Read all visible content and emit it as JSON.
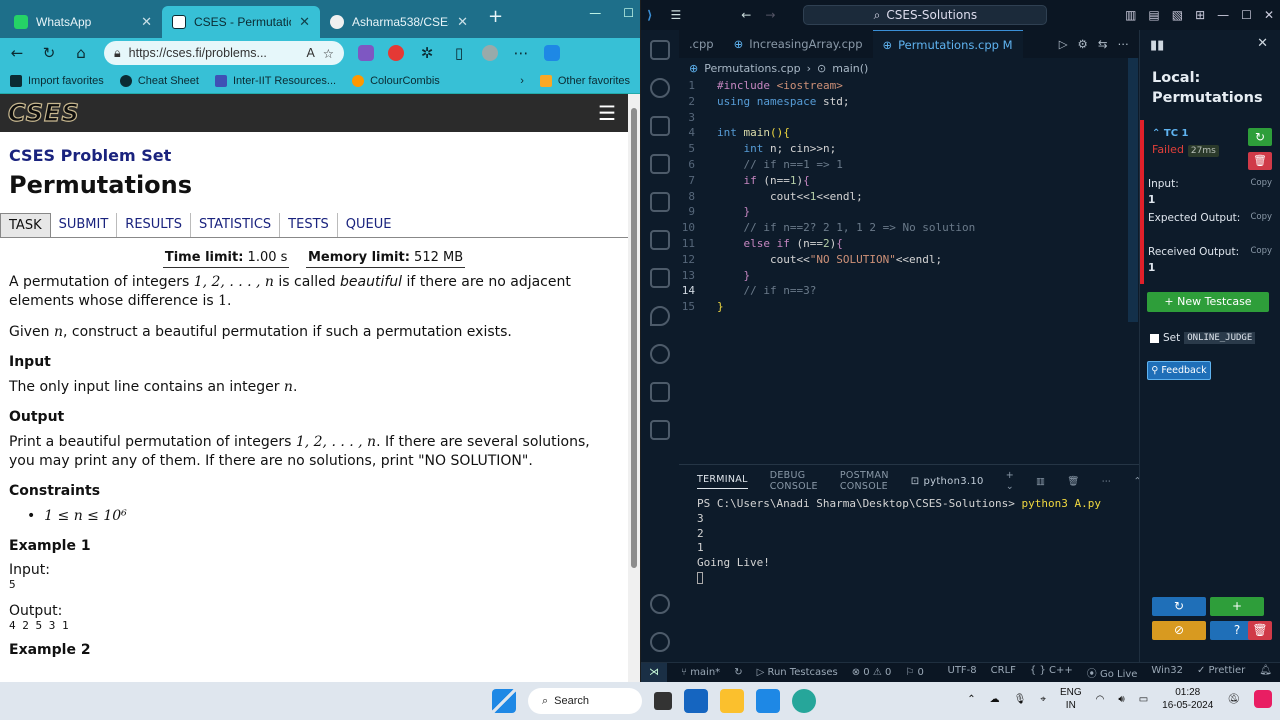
{
  "browser": {
    "tabs": [
      {
        "title": "WhatsApp",
        "active": false,
        "favicon_color": "#25d366"
      },
      {
        "title": "CSES - Permutations",
        "active": true,
        "favicon_color": "#ffffff"
      },
      {
        "title": "Asharma538/CSES-So",
        "active": false,
        "favicon_color": "#f0f0f0"
      }
    ],
    "url": "https://cses.fi/problems...",
    "bookmarks": [
      "Import favorites",
      "Cheat Sheet",
      "Inter-IIT Resources...",
      "ColourCombis",
      "Other favorites"
    ]
  },
  "cses": {
    "logo": "CSES",
    "problem_set": "CSES Problem Set",
    "title": "Permutations",
    "tabs": [
      "TASK",
      "SUBMIT",
      "RESULTS",
      "STATISTICS",
      "TESTS",
      "QUEUE"
    ],
    "time_label": "Time limit:",
    "time_value": "1.00 s",
    "memory_label": "Memory limit:",
    "memory_value": "512 MB",
    "p1a": "A permutation of integers ",
    "p1math": "1, 2, . . . , n",
    "p1b": " is called ",
    "p1em": "beautiful",
    "p1c": " if there are no adjacent elements whose difference is ",
    "p1one": "1",
    "p1d": ".",
    "p2a": "Given ",
    "p2n": "n",
    "p2b": ", construct a beautiful permutation if such a permutation exists.",
    "input_h": "Input",
    "input_a": "The only input line contains an integer ",
    "input_n": "n",
    "input_b": ".",
    "output_h": "Output",
    "output_a": "Print a beautiful permutation of integers ",
    "output_math": "1, 2, . . . , n",
    "output_b": ". If there are several solutions, you may print any of them. If there are no solutions, print \"NO SOLUTION\".",
    "constraints_h": "Constraints",
    "constraint": "1 ≤ n ≤ 10⁶",
    "example1_h": "Example 1",
    "ex_input_label": "Input:",
    "ex_input": "5",
    "ex_output_label": "Output:",
    "ex_output": "4 2 5 3 1",
    "example2_h": "Example 2"
  },
  "vscode": {
    "search": "CSES-Solutions",
    "tabs": [
      ".cpp",
      "IncreasingArray.cpp",
      "Permutations.cpp  M"
    ],
    "breadcrumb_file": "Permutations.cpp",
    "breadcrumb_fn": "main()",
    "panel_tabs": [
      "TERMINAL",
      "DEBUG CONSOLE",
      "POSTMAN CONSOLE"
    ],
    "shell": "python3.10",
    "terminal": [
      "PS C:\\Users\\Anadi Sharma\\Desktop\\CSES-Solutions> ",
      "3",
      "2",
      "1",
      "Going Live!"
    ],
    "terminal_cmd": "python3 A.py",
    "status": {
      "branch": "main*",
      "run": "Run Testcases",
      "errors": "0",
      "warnings": "0",
      "ports": "0",
      "encoding": "UTF-8",
      "eol": "CRLF",
      "lang": "C++",
      "golive": "Go Live",
      "platform": "Win32",
      "prettier": "Prettier"
    }
  },
  "cph": {
    "title_line1": "Local:",
    "title_line2": "Permutations",
    "tc_name": "TC 1",
    "tc_status": "Failed",
    "tc_time": "27ms",
    "input_label": "Input:",
    "input_value": "1",
    "expected_label": "Expected Output:",
    "received_label": "Received Output:",
    "received_value": "1",
    "copy": "Copy",
    "new_testcase": "+ New Testcase",
    "set_label": "Set",
    "online_judge": "ONLINE_JUDGE",
    "feedback": "Feedback"
  },
  "taskbar": {
    "search": "Search",
    "lang_1": "ENG",
    "lang_2": "IN",
    "time": "01:28",
    "date": "16-05-2024"
  },
  "colors": {
    "browser_accent": "#37c0d6",
    "vscode_bg": "#0d1b2a",
    "fail_red": "#e0202a",
    "pass_green": "#2e9e3a"
  }
}
